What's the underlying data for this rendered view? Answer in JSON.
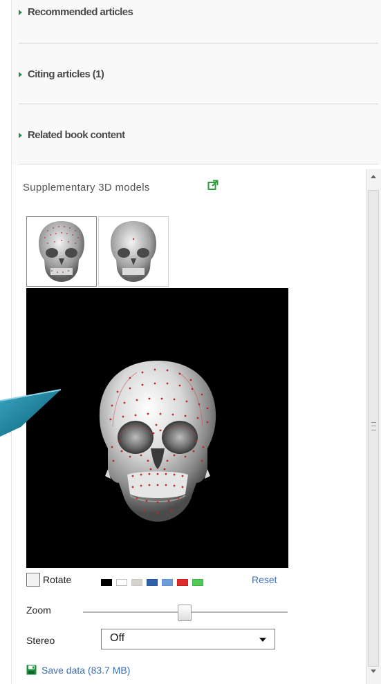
{
  "sidebar": {
    "sections": [
      {
        "label": "Recommended articles"
      },
      {
        "label": "Citing articles (1)"
      },
      {
        "label": "Related book content"
      }
    ]
  },
  "supplementary": {
    "title": "Supplementary 3D models",
    "thumbnails": [
      {
        "name": "skull-model-with-landmarks",
        "selected": true
      },
      {
        "name": "skull-model-plain",
        "selected": false
      }
    ],
    "controls": {
      "rotate_label": "Rotate",
      "rotate_checked": false,
      "colors": [
        "#000000",
        "#ffffff",
        "#d3d3cc",
        "#2f61a6",
        "#6f9bd8",
        "#e22c2c",
        "#53c95a"
      ],
      "reset_label": "Reset",
      "zoom_label": "Zoom",
      "zoom_value": 0.6,
      "stereo_label": "Stereo",
      "stereo_value": "Off",
      "save_label": "Save data (83.7 MB)"
    }
  },
  "colors": {
    "accent_link": "#3b6fb6",
    "viewer_background": "#000000",
    "overlay_arrow": "#0d6c88"
  }
}
